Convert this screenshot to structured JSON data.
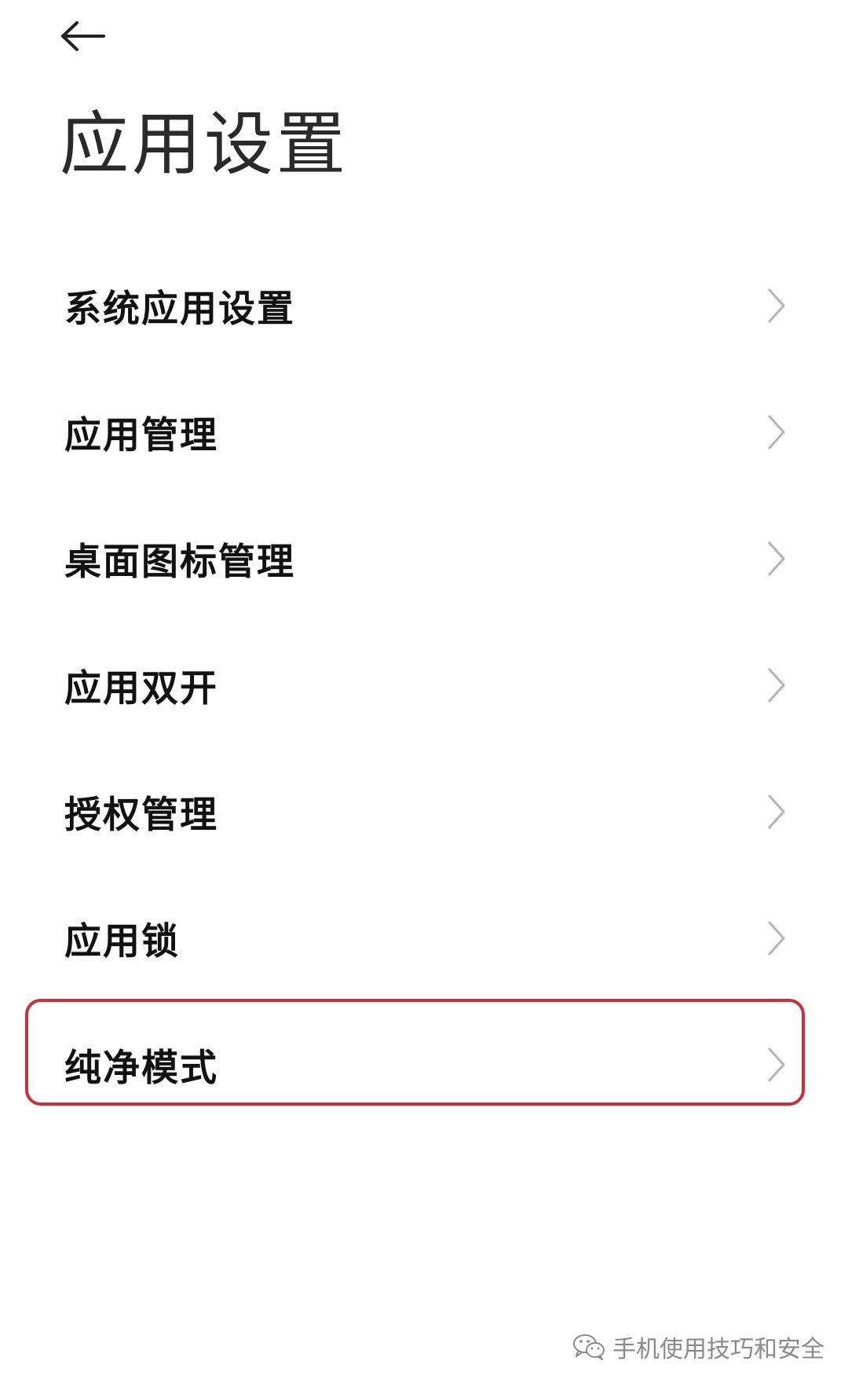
{
  "header": {
    "back_icon": "arrow-left-icon",
    "title": "应用设置"
  },
  "menu": {
    "items": [
      {
        "label": "系统应用设置"
      },
      {
        "label": "应用管理"
      },
      {
        "label": "桌面图标管理"
      },
      {
        "label": "应用双开"
      },
      {
        "label": "授权管理"
      },
      {
        "label": "应用锁"
      },
      {
        "label": "纯净模式"
      }
    ],
    "chevron_icon": "chevron-right-icon"
  },
  "highlight": {
    "item": "纯净模式",
    "color": "#c8303a"
  },
  "watermark": {
    "icon": "wechat-icon",
    "text": "手机使用技巧和安全"
  },
  "colors": {
    "background": "#ffffff",
    "text": "#111111",
    "chevron": "#b5b5b5"
  }
}
